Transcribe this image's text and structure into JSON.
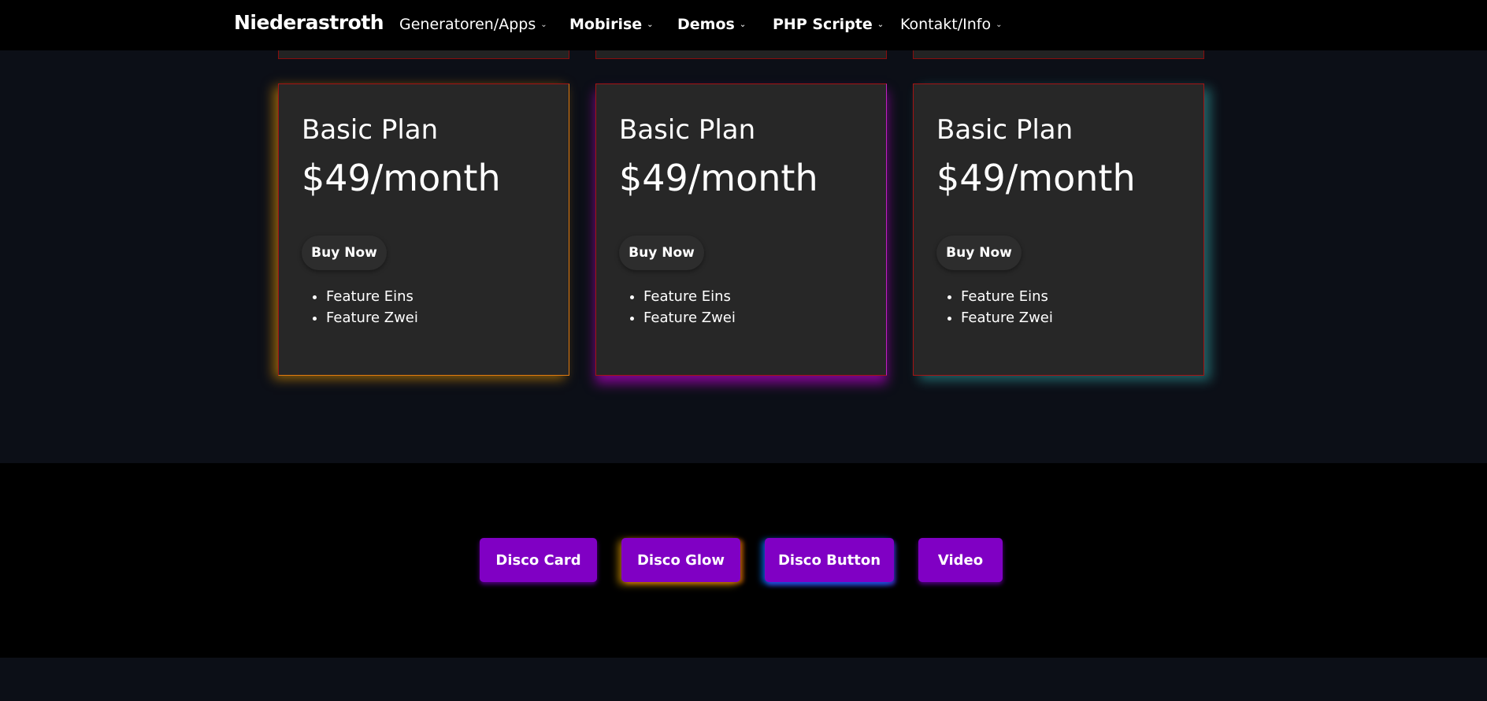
{
  "nav": {
    "brand": "Niederastroth",
    "items": [
      {
        "label": "Generatoren/Apps",
        "bold": false
      },
      {
        "label": "Mobirise",
        "bold": true
      },
      {
        "label": "Demos",
        "bold": true
      },
      {
        "label": "PHP Scripte",
        "bold": true
      },
      {
        "label": "Kontakt/Info",
        "bold": false
      }
    ],
    "chevron": "chevron-down-icon"
  },
  "pricing": {
    "cards": [
      {
        "plan": "Basic Plan",
        "price": "$49/month",
        "button": "Buy Now",
        "features": [
          "Feature Eins",
          "Feature Zwei"
        ],
        "glow": "#ffa500"
      },
      {
        "plan": "Basic Plan",
        "price": "$49/month",
        "button": "Buy Now",
        "features": [
          "Feature Eins",
          "Feature Zwei"
        ],
        "glow": "#c800dc"
      },
      {
        "plan": "Basic Plan",
        "price": "$49/month",
        "button": "Buy Now",
        "features": [
          "Feature Eins",
          "Feature Zwei"
        ],
        "glow": "#3cc8c8"
      }
    ]
  },
  "buttons": {
    "items": [
      "Disco Card",
      "Disco Glow",
      "Disco Button",
      "Video"
    ],
    "color": "#8000c4"
  }
}
